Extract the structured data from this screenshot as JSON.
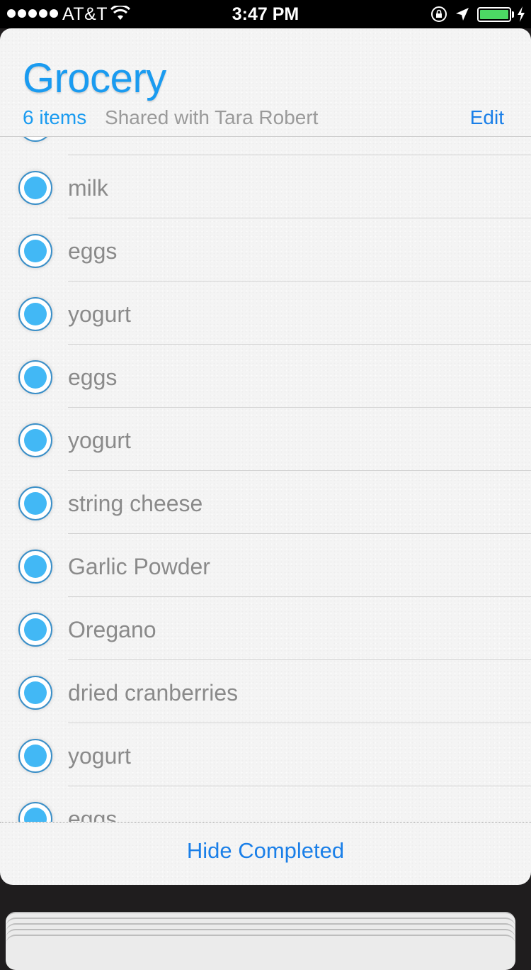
{
  "status_bar": {
    "carrier": "AT&T",
    "time": "3:47 PM",
    "battery_color": "#4cd964",
    "icons": [
      "signal-dots-icon",
      "wifi-icon",
      "rotation-lock-icon",
      "location-arrow-icon",
      "battery-icon",
      "charging-bolt-icon"
    ]
  },
  "list": {
    "title": "Grocery",
    "item_count": "6 items",
    "shared_with": "Shared with Tara Robert",
    "edit_label": "Edit",
    "accent_color": "#1a9bf0",
    "items": [
      {
        "label": ""
      },
      {
        "label": "milk"
      },
      {
        "label": "eggs"
      },
      {
        "label": "yogurt"
      },
      {
        "label": "eggs"
      },
      {
        "label": "yogurt"
      },
      {
        "label": "string cheese"
      },
      {
        "label": "Garlic Powder"
      },
      {
        "label": "Oregano"
      },
      {
        "label": "dried cranberries"
      },
      {
        "label": "yogurt"
      },
      {
        "label": "eggs"
      }
    ]
  },
  "footer": {
    "hide_completed_label": "Hide Completed"
  }
}
